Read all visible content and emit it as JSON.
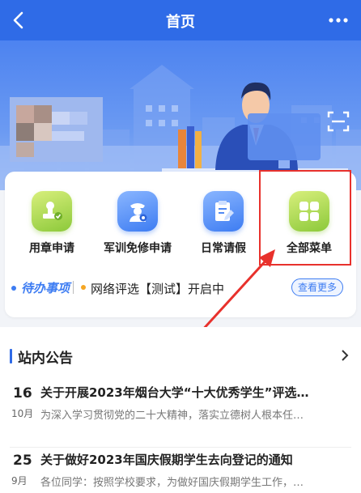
{
  "header": {
    "title": "首页"
  },
  "menu": [
    {
      "label": "用章申请",
      "icon": "seal-icon"
    },
    {
      "label": "军训免修申请",
      "icon": "military-badge-icon"
    },
    {
      "label": "日常请假",
      "icon": "leave-form-icon"
    },
    {
      "label": "全部菜单",
      "icon": "grid-icon"
    }
  ],
  "todo": {
    "title": "待办事项",
    "text": "网络评选【测试】开启中",
    "more": "查看更多"
  },
  "notice": {
    "title": "站内公告",
    "items": [
      {
        "day": "16",
        "month": "10月",
        "headline": "关于开展2023年烟台大学“十大优秀学生”评选…",
        "summary": "为深入学习贯彻党的二十大精神，落实立德树人根本任…"
      },
      {
        "day": "25",
        "month": "9月",
        "headline": "关于做好2023年国庆假期学生去向登记的通知",
        "summary": "各位同学：按照学校要求，为做好国庆假期学生工作，…"
      }
    ]
  },
  "colors": {
    "primary": "#2f6be7",
    "accent_green": "#8cc93a",
    "highlight_red": "#e8312c"
  }
}
